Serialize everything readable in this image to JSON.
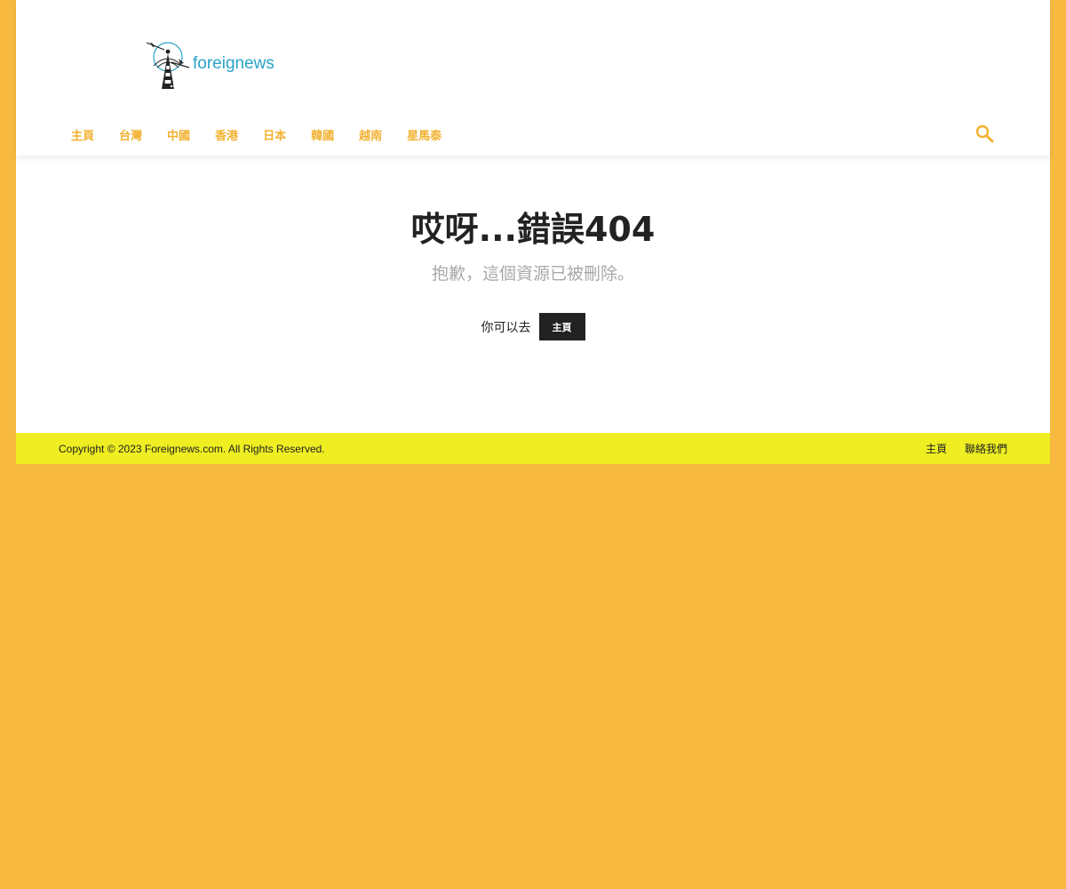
{
  "logo": {
    "text": "foreignews",
    "icon": "radio-tower-icon"
  },
  "nav": {
    "items": [
      "主頁",
      "台灣",
      "中國",
      "香港",
      "日本",
      "韓國",
      "越南",
      "星馬泰"
    ],
    "search_icon": "search-icon"
  },
  "error": {
    "title": "哎呀...錯誤404",
    "subtitle": "抱歉，這個資源已被刪除。",
    "goto_label": "你可以去",
    "home_button": "主頁"
  },
  "footer": {
    "copyright": "Copyright © 2023 Foreignews.com. All Rights Reserved.",
    "links": [
      "主頁",
      "聯絡我們"
    ]
  },
  "colors": {
    "background": "#f7b93f",
    "nav_text": "#f2b12f",
    "logo_text": "#2aa3c9",
    "footer_bar": "#eeee22",
    "button_bg": "#222222"
  }
}
